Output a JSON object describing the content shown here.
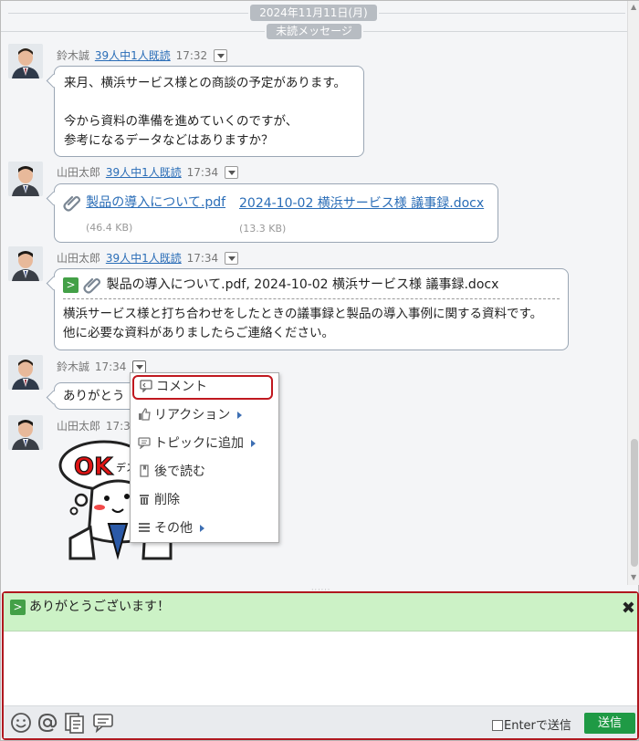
{
  "header": {
    "date": "2024年11月11日(月)",
    "unread_label": "未読メッセージ"
  },
  "messages": [
    {
      "sender": "鈴木誠",
      "read": "39人中1人既読",
      "time": "17:32",
      "lines": [
        "来月、横浜サービス様との商談の予定があります。",
        "",
        "今から資料の準備を進めていくのですが、",
        "参考になるデータなどはありますか？"
      ]
    },
    {
      "sender": "山田太郎",
      "read": "39人中1人既読",
      "time": "17:34",
      "files": [
        {
          "name": "製品の導入について.pdf",
          "size": "(46.4 KB)"
        },
        {
          "name": "2024-10-02 横浜サービス様 議事録.docx",
          "size": "(13.3 KB)"
        }
      ]
    },
    {
      "sender": "山田太郎",
      "read": "39人中1人既読",
      "time": "17:34",
      "quote_mark": ">",
      "quoted": "製品の導入について.pdf, 2024-10-02 横浜サービス様 議事録.docx",
      "lines": [
        "横浜サービス様と打ち合わせをしたときの議事録と製品の導入事例に関する資料です。",
        "他に必要な資料がありましたらご連絡ください。"
      ]
    },
    {
      "sender": "鈴木誠",
      "time": "17:34",
      "text": "ありがとう"
    },
    {
      "sender": "山田太郎",
      "time": "17:3",
      "stamp_text": "OKデス。"
    }
  ],
  "context_menu": {
    "items": [
      {
        "label": "コメント",
        "icon": "comment-icon",
        "submenu": false
      },
      {
        "label": "リアクション",
        "icon": "thumbs-up-icon",
        "submenu": true
      },
      {
        "label": "トピックに追加",
        "icon": "topic-icon",
        "submenu": true
      },
      {
        "label": "後で読む",
        "icon": "bookmark-icon",
        "submenu": false
      },
      {
        "label": "削除",
        "icon": "trash-icon",
        "submenu": false
      },
      {
        "label": "その他",
        "icon": "menu-icon",
        "submenu": true
      }
    ]
  },
  "composer": {
    "quote_mark": ">",
    "quote_text": "ありがとうございます！",
    "close_glyph": "✖",
    "enter_send_label": "Enterで送信",
    "send_label": "送信",
    "tools": [
      "smiley-icon",
      "mention-icon",
      "template-icon",
      "topic-icon"
    ]
  },
  "colors": {
    "accent_red": "#c0181f",
    "send_green": "#1f9a45",
    "link_blue": "#2a6db7",
    "quote_bg": "#ccf2c6"
  }
}
